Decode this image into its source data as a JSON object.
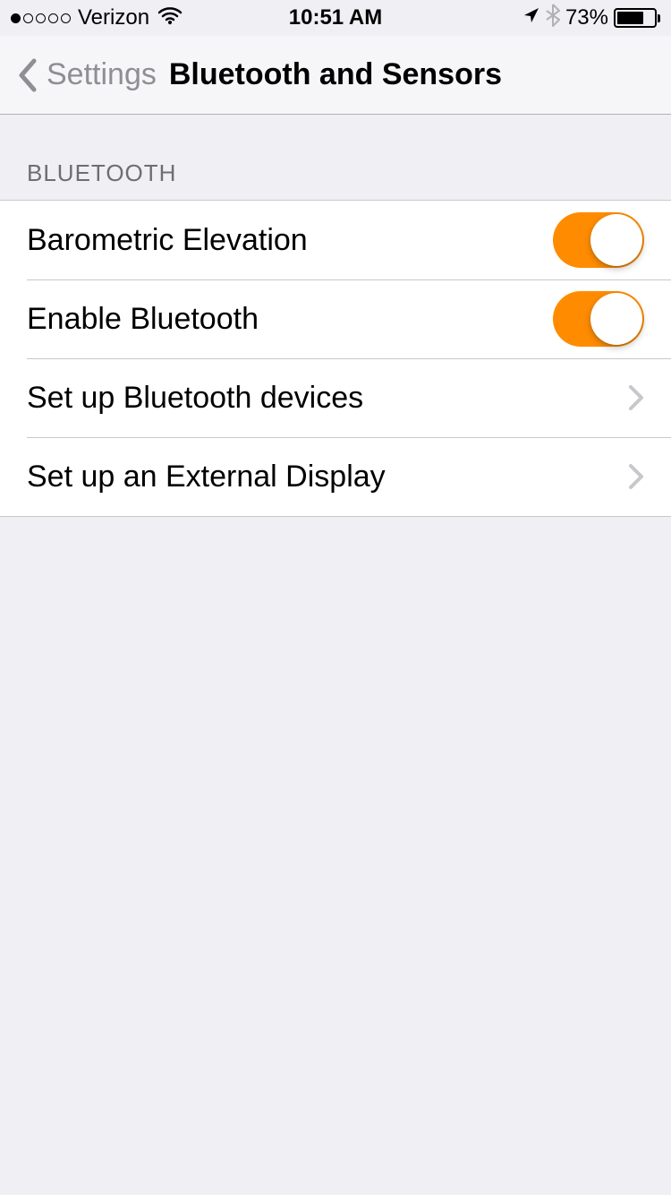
{
  "status": {
    "carrier": "Verizon",
    "time": "10:51 AM",
    "battery_pct": "73%"
  },
  "nav": {
    "back_label": "Settings",
    "title": "Bluetooth and Sensors"
  },
  "section": {
    "header": "Bluetooth"
  },
  "rows": {
    "barometric": {
      "label": "Barometric Elevation",
      "on": true
    },
    "enable_bt": {
      "label": "Enable Bluetooth",
      "on": true
    },
    "setup_bt": {
      "label": "Set up Bluetooth devices"
    },
    "setup_display": {
      "label": "Set up an External Display"
    }
  }
}
